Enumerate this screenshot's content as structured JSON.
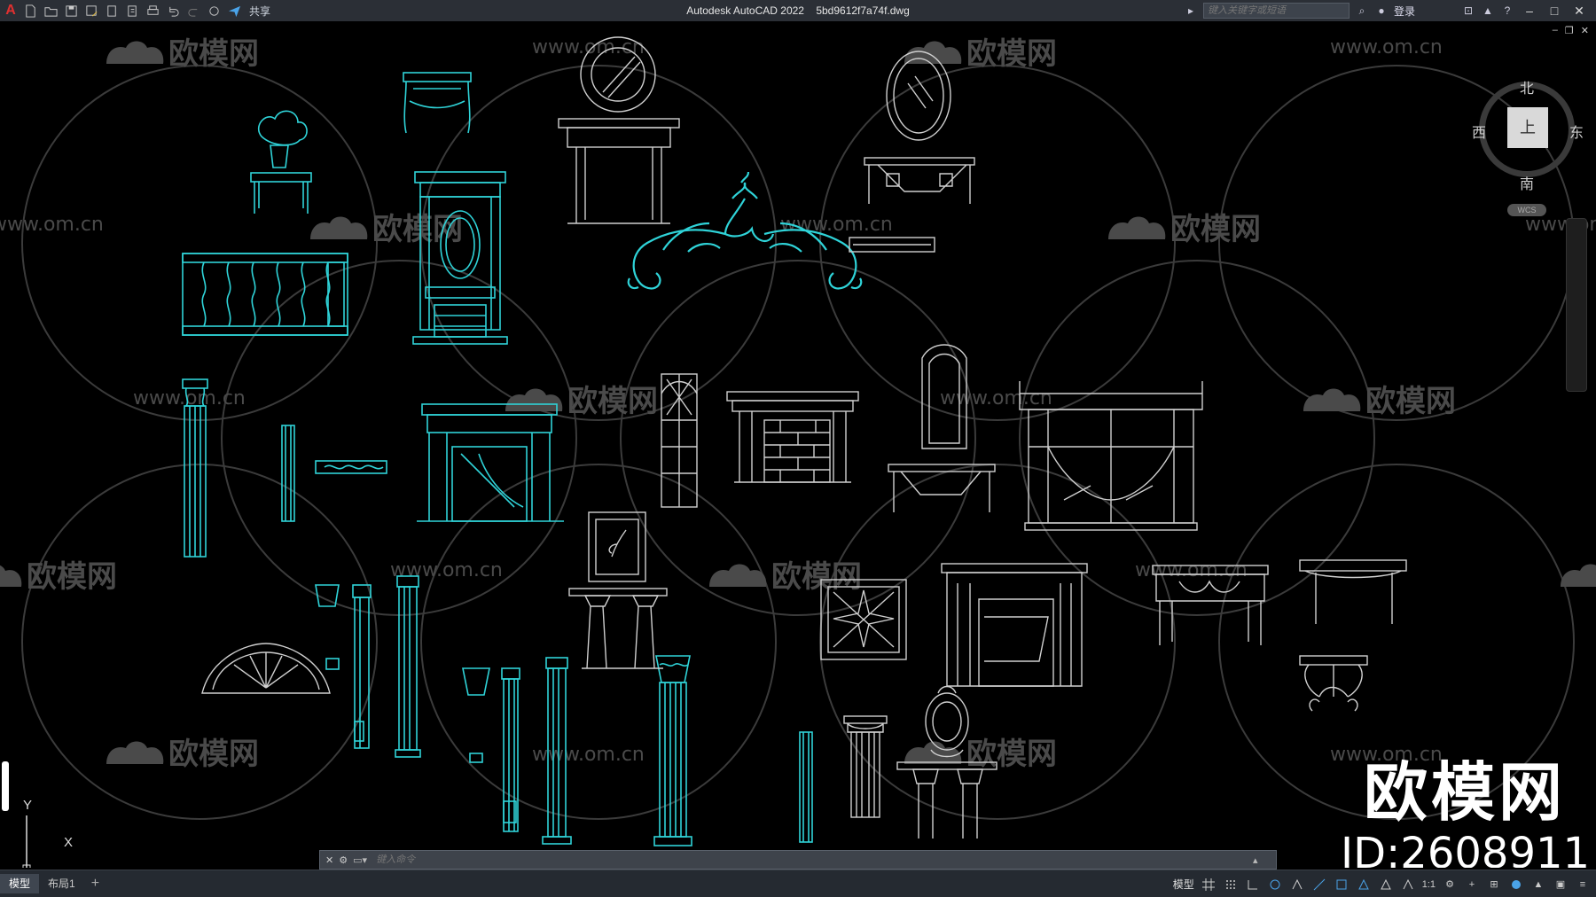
{
  "app": {
    "title": "Autodesk AutoCAD 2022",
    "file": "5bd9612f7a74f.dwg",
    "share_label": "共享",
    "search_placeholder": "键入关键字或短语",
    "login_label": "登录"
  },
  "viewcube": {
    "north": "北",
    "south": "南",
    "east": "东",
    "west": "西",
    "face": "上",
    "wcs": "WCS"
  },
  "ucs": {
    "x": "X",
    "y": "Y"
  },
  "command": {
    "placeholder": "键入命令"
  },
  "watermark": {
    "logo_text": "欧模网",
    "url": "www.om.cn",
    "id_text": "ID:2608911"
  },
  "tabs": [
    {
      "label": "模型"
    },
    {
      "label": "布局1"
    }
  ],
  "status": {
    "model_label": "模型",
    "scale": "1:1"
  },
  "colors": {
    "cyan": "#2fd3d8",
    "light_gray": "#cfcfcf",
    "background": "#000000"
  }
}
